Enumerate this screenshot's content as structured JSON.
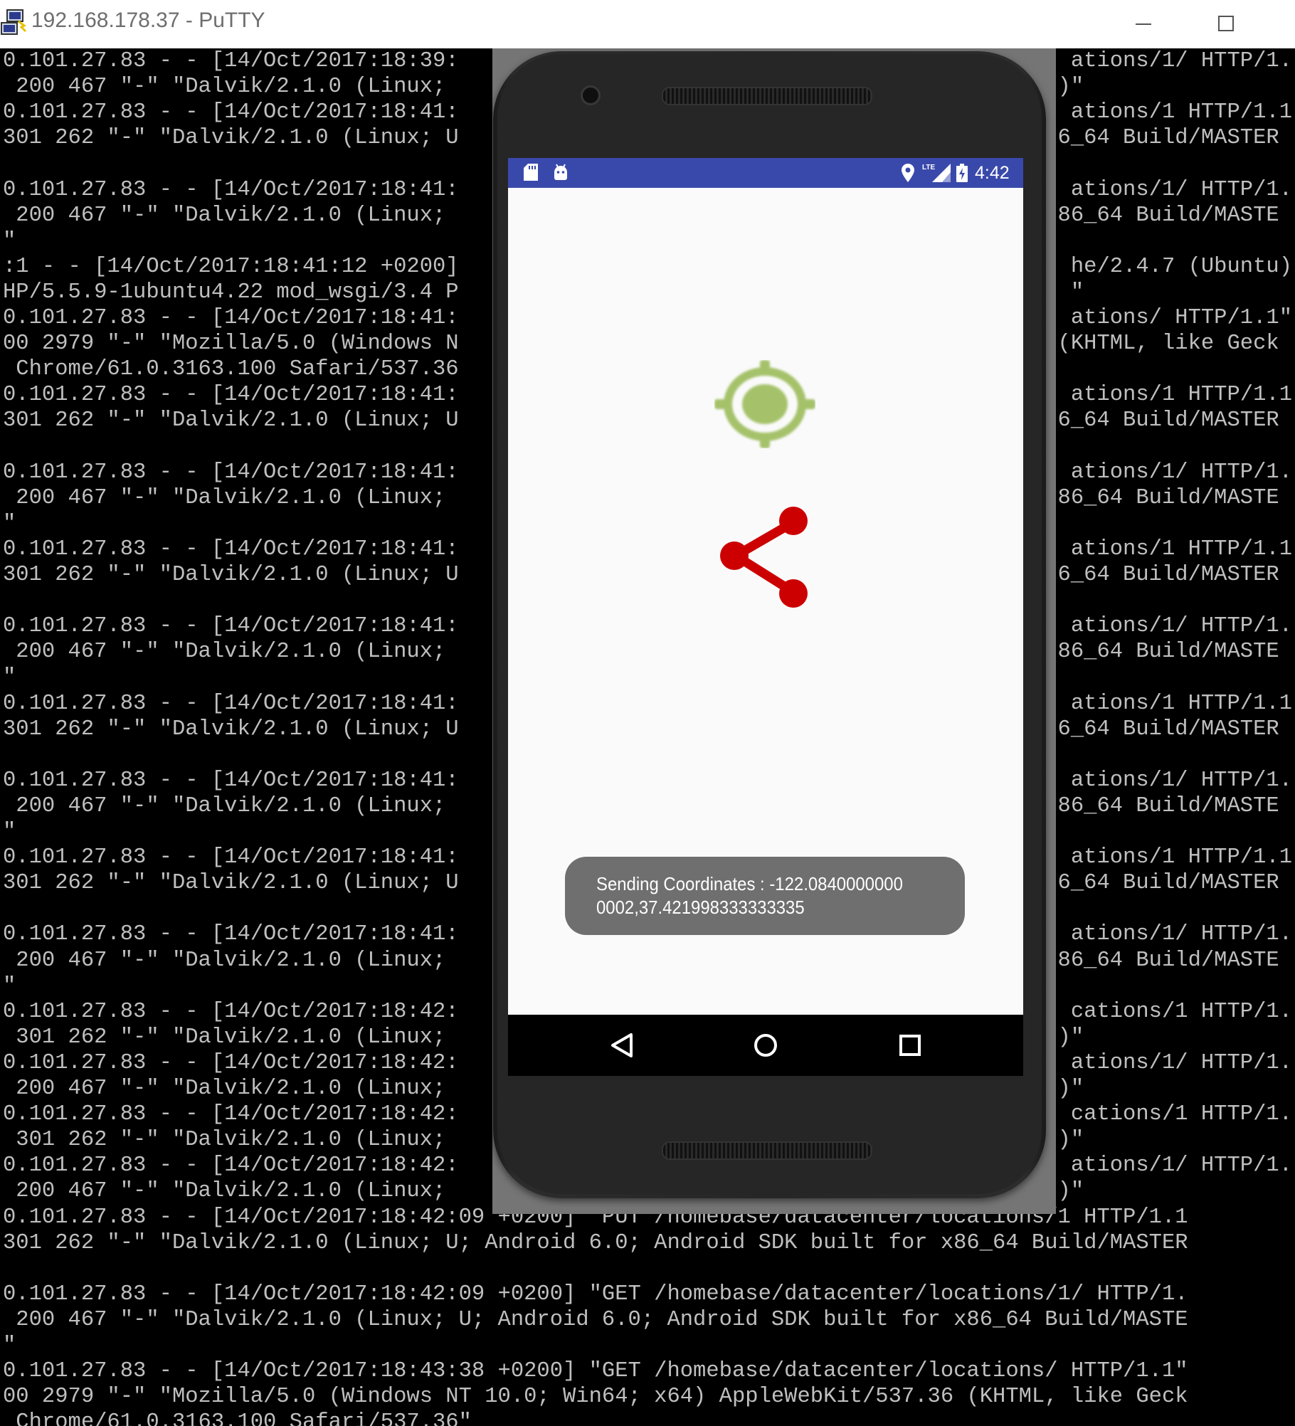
{
  "window": {
    "title": "192.168.178.37 - PuTTY",
    "app_icon": "putty-icon",
    "controls": [
      "minimize-icon",
      "maximize-icon"
    ]
  },
  "terminal": {
    "lines": [
      "0.101.27.83 - - [14/Oct/2017:18:39:                                               ations/1/ HTTP/1.",
      " 200 467 \"-\" \"Dalvik/2.1.0 (Linux;                                               )\"",
      "0.101.27.83 - - [14/Oct/2017:18:41:                                               ations/1 HTTP/1.1",
      "301 262 \"-\" \"Dalvik/2.1.0 (Linux; U                                              6_64 Build/MASTER",
      "",
      "0.101.27.83 - - [14/Oct/2017:18:41:                                               ations/1/ HTTP/1.",
      " 200 467 \"-\" \"Dalvik/2.1.0 (Linux;                                               86_64 Build/MASTE",
      "\"",
      ":1 - - [14/Oct/2017:18:41:12 +0200]                                               he/2.4.7 (Ubuntu)",
      "HP/5.5.9-1ubuntu4.22 mod_wsgi/3.4 P                                               \"",
      "0.101.27.83 - - [14/Oct/2017:18:41:                                               ations/ HTTP/1.1\"",
      "00 2979 \"-\" \"Mozilla/5.0 (Windows N                                              (KHTML, like Geck",
      " Chrome/61.0.3163.100 Safari/537.36",
      "0.101.27.83 - - [14/Oct/2017:18:41:                                               ations/1 HTTP/1.1",
      "301 262 \"-\" \"Dalvik/2.1.0 (Linux; U                                              6_64 Build/MASTER",
      "",
      "0.101.27.83 - - [14/Oct/2017:18:41:                                               ations/1/ HTTP/1.",
      " 200 467 \"-\" \"Dalvik/2.1.0 (Linux;                                               86_64 Build/MASTE",
      "\"",
      "0.101.27.83 - - [14/Oct/2017:18:41:                                               ations/1 HTTP/1.1",
      "301 262 \"-\" \"Dalvik/2.1.0 (Linux; U                                              6_64 Build/MASTER",
      "",
      "0.101.27.83 - - [14/Oct/2017:18:41:                                               ations/1/ HTTP/1.",
      " 200 467 \"-\" \"Dalvik/2.1.0 (Linux;                                               86_64 Build/MASTE",
      "\"",
      "0.101.27.83 - - [14/Oct/2017:18:41:                                               ations/1 HTTP/1.1",
      "301 262 \"-\" \"Dalvik/2.1.0 (Linux; U                                              6_64 Build/MASTER",
      "",
      "0.101.27.83 - - [14/Oct/2017:18:41:                                               ations/1/ HTTP/1.",
      " 200 467 \"-\" \"Dalvik/2.1.0 (Linux;                                               86_64 Build/MASTE",
      "\"",
      "0.101.27.83 - - [14/Oct/2017:18:41:                                               ations/1 HTTP/1.1",
      "301 262 \"-\" \"Dalvik/2.1.0 (Linux; U                                              6_64 Build/MASTER",
      "",
      "0.101.27.83 - - [14/Oct/2017:18:41:                                               ations/1/ HTTP/1.",
      " 200 467 \"-\" \"Dalvik/2.1.0 (Linux;                                               86_64 Build/MASTE",
      "\"",
      "0.101.27.83 - - [14/Oct/2017:18:42:                                               cations/1 HTTP/1.",
      " 301 262 \"-\" \"Dalvik/2.1.0 (Linux;                                               )\"",
      "0.101.27.83 - - [14/Oct/2017:18:42:                                               ations/1/ HTTP/1.",
      " 200 467 \"-\" \"Dalvik/2.1.0 (Linux;                                               )\"",
      "0.101.27.83 - - [14/Oct/2017:18:42:                                               cations/1 HTTP/1.",
      " 301 262 \"-\" \"Dalvik/2.1.0 (Linux;                                               )\"",
      "0.101.27.83 - - [14/Oct/2017:18:42:                                               ations/1/ HTTP/1.",
      " 200 467 \"-\" \"Dalvik/2.1.0 (Linux;                                               )\"",
      "0.101.27.83 - - [14/Oct/2017:18:42:09 +0200] \"PUT /homebase/datacenter/locations/1 HTTP/1.1",
      "301 262 \"-\" \"Dalvik/2.1.0 (Linux; U; Android 6.0; Android SDK built for x86_64 Build/MASTER",
      "",
      "0.101.27.83 - - [14/Oct/2017:18:42:09 +0200] \"GET /homebase/datacenter/locations/1/ HTTP/1.",
      " 200 467 \"-\" \"Dalvik/2.1.0 (Linux; U; Android 6.0; Android SDK built for x86_64 Build/MASTE",
      "\"",
      "0.101.27.83 - - [14/Oct/2017:18:43:38 +0200] \"GET /homebase/datacenter/locations/ HTTP/1.1\"",
      "00 2979 \"-\" \"Mozilla/5.0 (Windows NT 10.0; Win64; x64) AppleWebKit/537.36 (KHTML, like Geck",
      " Chrome/61.0.3163.100 Safari/537.36\""
    ]
  },
  "android": {
    "statusbar": {
      "left_icons": [
        "sd-card-icon",
        "android-debug-icon"
      ],
      "right_icons": [
        "location-icon",
        "lte-signal-icon",
        "battery-charging-icon"
      ],
      "signal_label": "LTE",
      "time": "4:42",
      "color": "#3949ab"
    },
    "content": {
      "icons": [
        "gps-target-icon",
        "share-icon"
      ],
      "gps_color": "#a5c26a",
      "share_color": "#cc0000"
    },
    "toast": {
      "text": "Sending Coordinates : -122.08400000000002,37.421998333333335"
    },
    "navbar": [
      "back-icon",
      "home-icon",
      "recents-icon"
    ]
  }
}
